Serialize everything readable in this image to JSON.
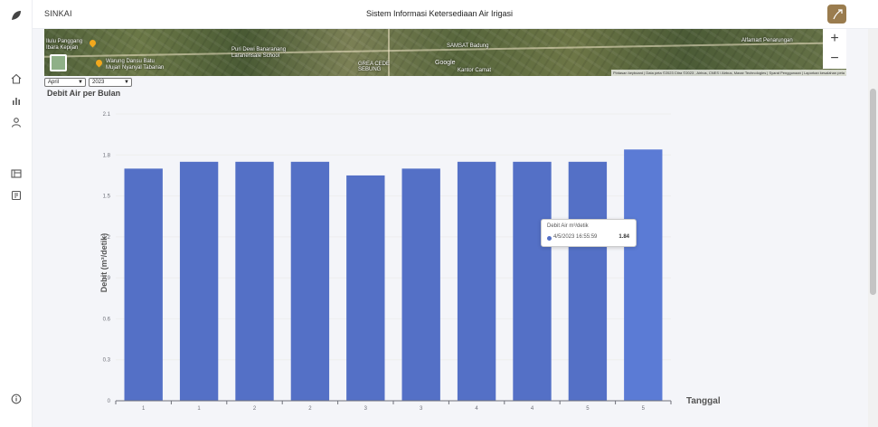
{
  "header": {
    "app_name": "SINKAI",
    "title": "Sistem Informasi Ketersediaan Air Irigasi"
  },
  "sidebar": {
    "items": [
      {
        "icon": "leaf-logo-icon"
      },
      {
        "icon": "home-icon"
      },
      {
        "icon": "bar-chart-icon"
      },
      {
        "icon": "user-icon"
      },
      {
        "icon": "map-icon"
      },
      {
        "icon": "report-icon"
      },
      {
        "icon": "info-icon"
      }
    ]
  },
  "map": {
    "labels": [
      "Ilulu Panggang",
      "Ibara Kepijan",
      "Warung Dansu Batu",
      "Mujan Nyanyal Tabanan",
      "Puri Dewi Banaranang",
      "Laranensale School",
      "GREA CEDE",
      "SEBUNG",
      "SAMSAT Badung",
      "Kantor Camat",
      "Google",
      "Alfamart Penarungan"
    ],
    "zoom_in": "+",
    "zoom_out": "−",
    "attribution": "Pintasan keyboard | Data peta ©2023 Citra ©2023 , Airbus, CNES / Airbus, Maxar Technologies | Syarat Penggunaan | Laporkan kesalahan peta"
  },
  "filters": {
    "month": "April",
    "year": "2023"
  },
  "chart_heading": "Debit Air per Bulan",
  "tooltip": {
    "title": "Debit Air m³/detik",
    "label": "4/5/2023 16:55:59",
    "value": "1.84"
  },
  "chart_data": {
    "type": "bar",
    "title": "",
    "xlabel": "Tanggal",
    "ylabel": "Debit (m³/detik)",
    "categories": [
      "1",
      "1",
      "2",
      "2",
      "3",
      "3",
      "4",
      "4",
      "5",
      "5"
    ],
    "values": [
      1.7,
      1.75,
      1.75,
      1.75,
      1.65,
      1.7,
      1.75,
      1.75,
      1.75,
      1.84
    ],
    "highlighted_index": 9,
    "ylim": [
      0,
      2.1
    ],
    "yticks": [
      0,
      0.3,
      0.6,
      0.9,
      1.2,
      1.5,
      1.8,
      2.1
    ],
    "ytick_labels": [
      "0",
      "0.3",
      "0.6",
      "0.9",
      "1.2",
      "1.5",
      "1.8",
      "2.1"
    ],
    "grid": true,
    "colors": {
      "bar": "#5470c6",
      "highlight": "#5b7bd5",
      "grid": "#eeeeee",
      "axis": "#6e7079"
    }
  }
}
